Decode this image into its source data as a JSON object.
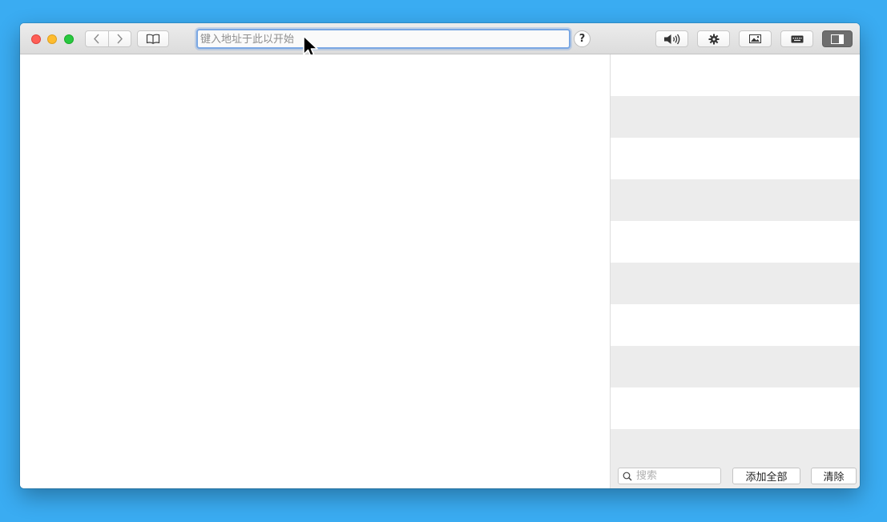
{
  "toolbar": {
    "address_placeholder": "键入地址于此以开始",
    "help_label": "?"
  },
  "sidebar": {
    "row_count": 10,
    "search_placeholder": "搜索",
    "add_all_label": "添加全部",
    "clear_label": "清除"
  },
  "colors": {
    "desktop": "#3aacf2",
    "focus_ring": "#7aa7e3",
    "active_toggle": "#6e6e6e"
  },
  "icons": [
    "back-chevron-icon",
    "forward-chevron-icon",
    "book-icon",
    "speaker-icon",
    "gear-icon",
    "image-icon",
    "keyboard-icon",
    "sidebar-icon",
    "search-icon",
    "mouse-cursor-icon"
  ]
}
